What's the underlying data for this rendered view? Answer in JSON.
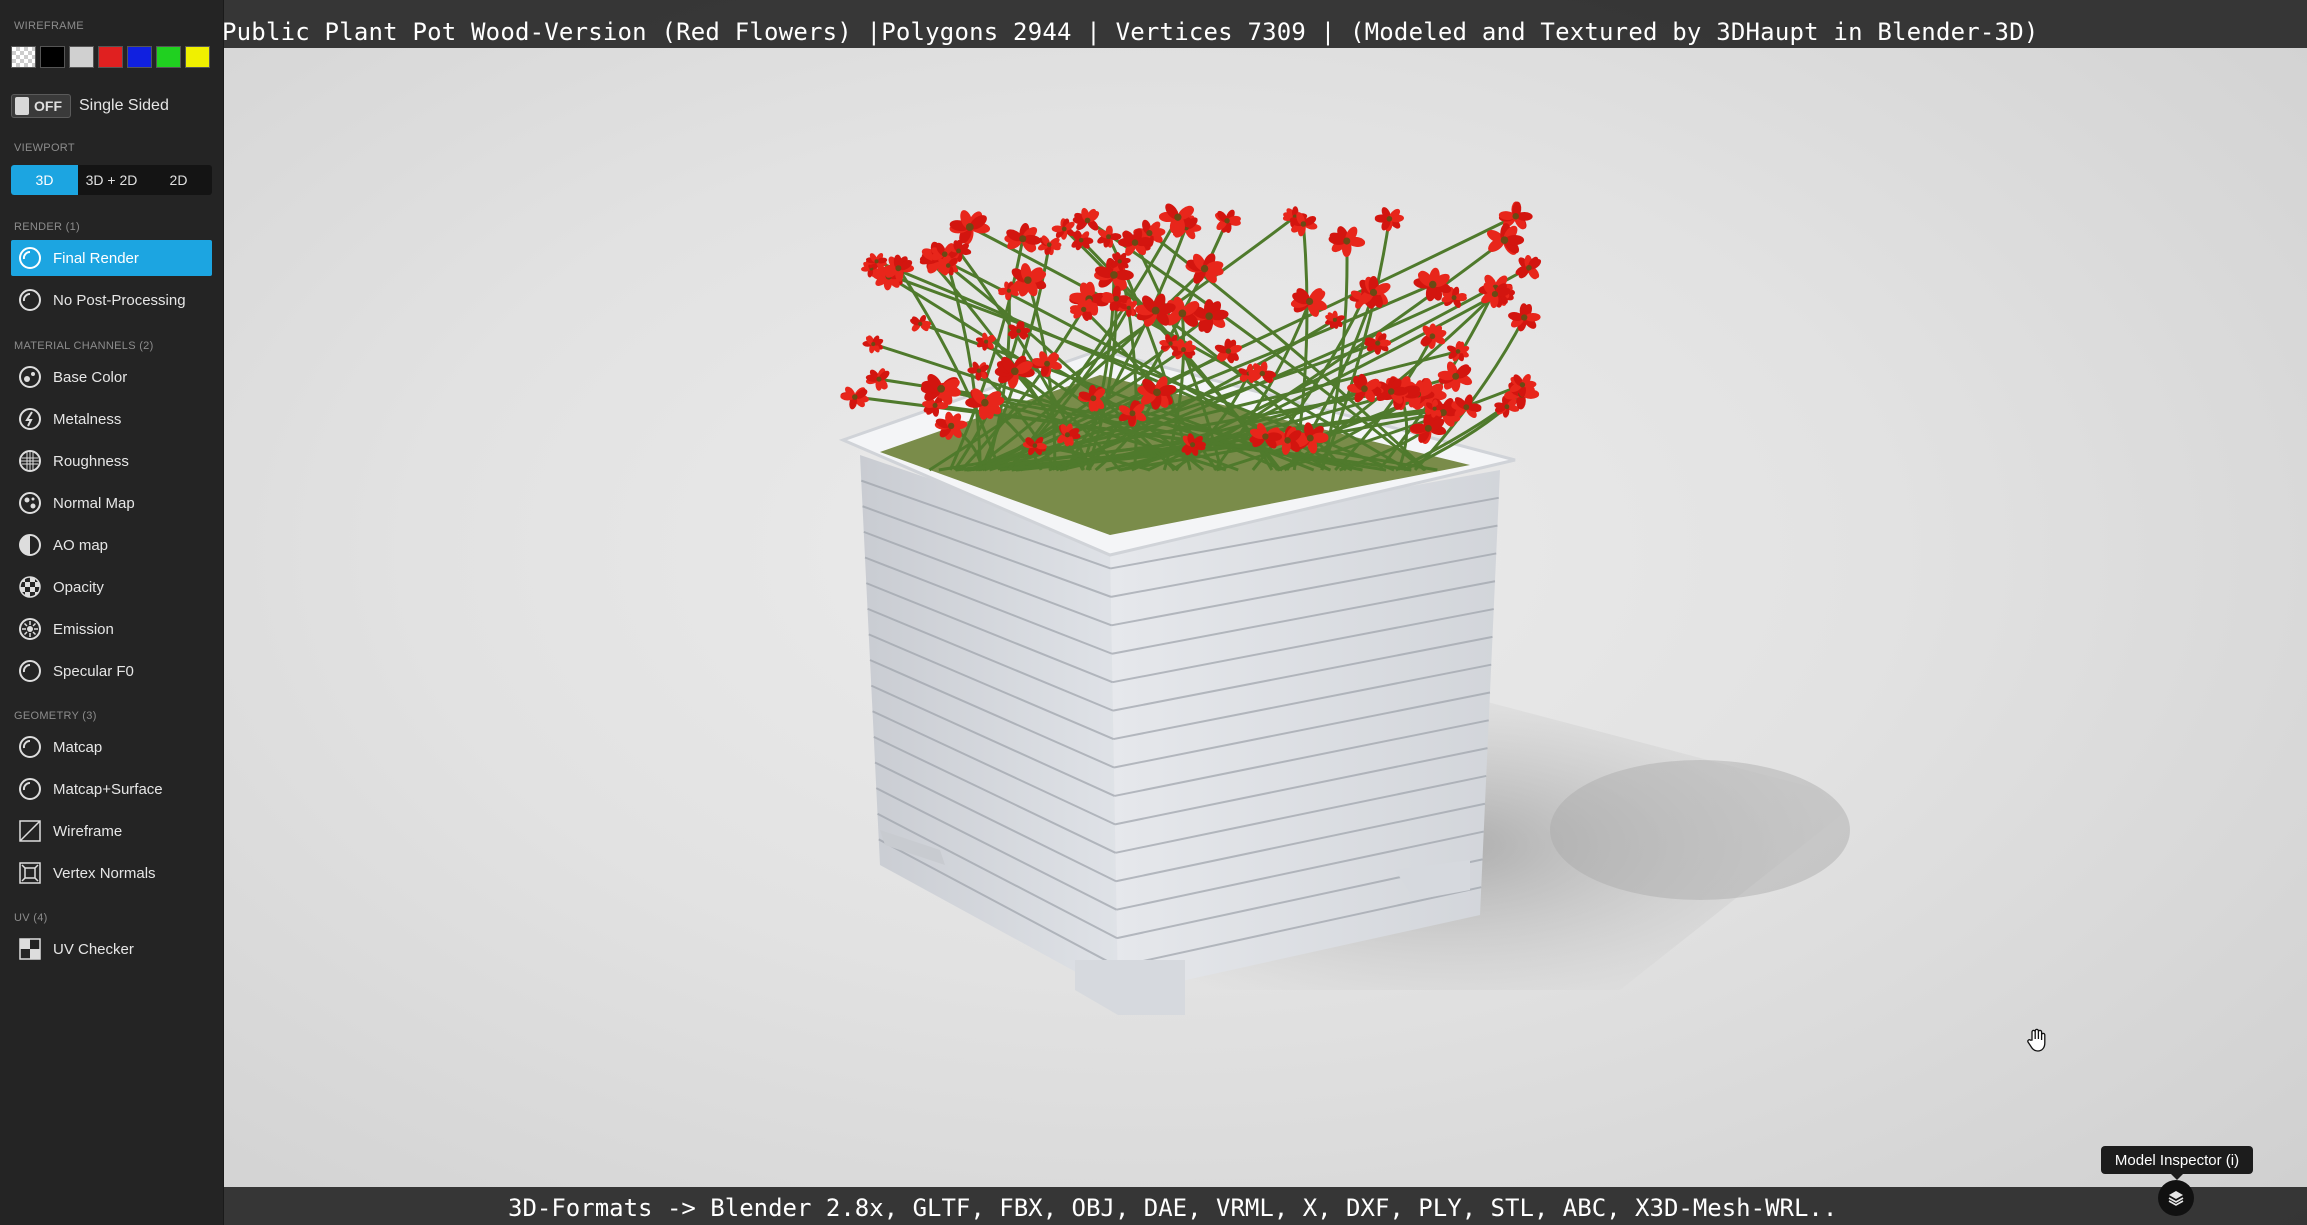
{
  "title": "Public Plant Pot Wood-Version (Red Flowers) |Polygons 2944 | Vertices 7309 | (Modeled and Textured by 3DHaupt in Blender-3D)",
  "footer": "3D-Formats -> Blender 2.8x, GLTF, FBX, OBJ, DAE, VRML, X, DXF, PLY, STL, ABC, X3D-Mesh-WRL..",
  "tooltip": "Model Inspector (i)",
  "sidebar": {
    "wireframe_header": "WIREFRAME",
    "wireframe_colors": [
      "checker",
      "#000000",
      "#d0d0d0",
      "#e02020",
      "#1020e0",
      "#20d020",
      "#f0f000"
    ],
    "single_sided": {
      "state": "OFF",
      "label": "Single Sided"
    },
    "viewport_header": "VIEWPORT",
    "viewport_modes": [
      "3D",
      "3D + 2D",
      "2D"
    ],
    "viewport_active": "3D",
    "render_header": "RENDER (1)",
    "render_items": [
      {
        "label": "Final Render",
        "icon": "final-render-icon",
        "active": true
      },
      {
        "label": "No Post-Processing",
        "icon": "no-post-processing-icon",
        "active": false
      }
    ],
    "material_header": "MATERIAL CHANNELS (2)",
    "material_items": [
      {
        "label": "Base Color",
        "icon": "base-color-icon"
      },
      {
        "label": "Metalness",
        "icon": "metalness-icon"
      },
      {
        "label": "Roughness",
        "icon": "roughness-icon"
      },
      {
        "label": "Normal Map",
        "icon": "normal-map-icon"
      },
      {
        "label": "AO map",
        "icon": "ao-map-icon"
      },
      {
        "label": "Opacity",
        "icon": "opacity-icon"
      },
      {
        "label": "Emission",
        "icon": "emission-icon"
      },
      {
        "label": "Specular F0",
        "icon": "specular-f0-icon"
      }
    ],
    "geometry_header": "GEOMETRY (3)",
    "geometry_items": [
      {
        "label": "Matcap",
        "icon": "matcap-icon"
      },
      {
        "label": "Matcap+Surface",
        "icon": "matcap-surface-icon"
      },
      {
        "label": "Wireframe",
        "icon": "wireframe-icon"
      },
      {
        "label": "Vertex Normals",
        "icon": "vertex-normals-icon"
      }
    ],
    "uv_header": "UV (4)",
    "uv_items": [
      {
        "label": "UV Checker",
        "icon": "uv-checker-icon"
      }
    ]
  },
  "colors": {
    "accent": "#1ca5e1",
    "sidebar_bg": "#242424",
    "flower_red": "#d01a14",
    "pot_white": "#eef0f3"
  }
}
